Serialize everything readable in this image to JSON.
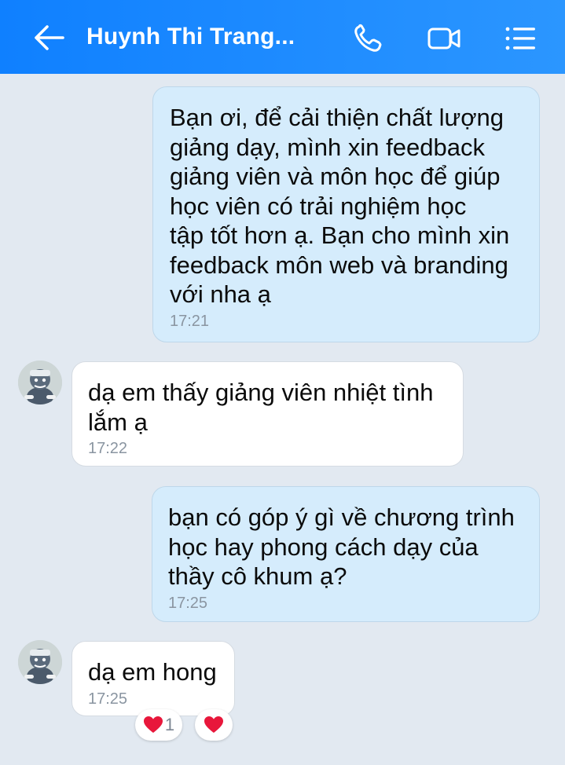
{
  "header": {
    "title": "Huynh Thi Trang...",
    "bg_color": "#1a88ff",
    "icons": [
      "back-arrow-icon",
      "phone-icon",
      "video-call-icon",
      "menu-list-icon"
    ]
  },
  "messages": [
    {
      "direction": "outgoing",
      "text": "Bạn ơi, để cải thiện chất lượng\ngiảng dạy, mình xin feedback\ngiảng viên và môn học để giúp\nhọc viên có trải nghiệm học\ntập tốt hơn ạ. Bạn cho mình xin\nfeedback môn web và branding\nvới nha ạ",
      "time": "17:21"
    },
    {
      "direction": "incoming",
      "text": "dạ em thấy giảng viên nhiệt tình\nlắm ạ",
      "time": "17:22"
    },
    {
      "direction": "outgoing",
      "text": "bạn có góp ý gì về chương trình\nhọc hay phong cách dạy của\nthầy cô khum ạ?",
      "time": "17:25"
    },
    {
      "direction": "incoming",
      "text": "dạ em hong",
      "time": "17:25",
      "reactions": [
        {
          "icon": "heart-icon",
          "count": "1"
        },
        {
          "icon": "heart-icon",
          "count": ""
        }
      ]
    }
  ],
  "colors": {
    "outgoing_bubble": "#d5ecfc",
    "incoming_bubble": "#ffffff",
    "background": "#e2e9f1",
    "heart": "#e8173b"
  }
}
